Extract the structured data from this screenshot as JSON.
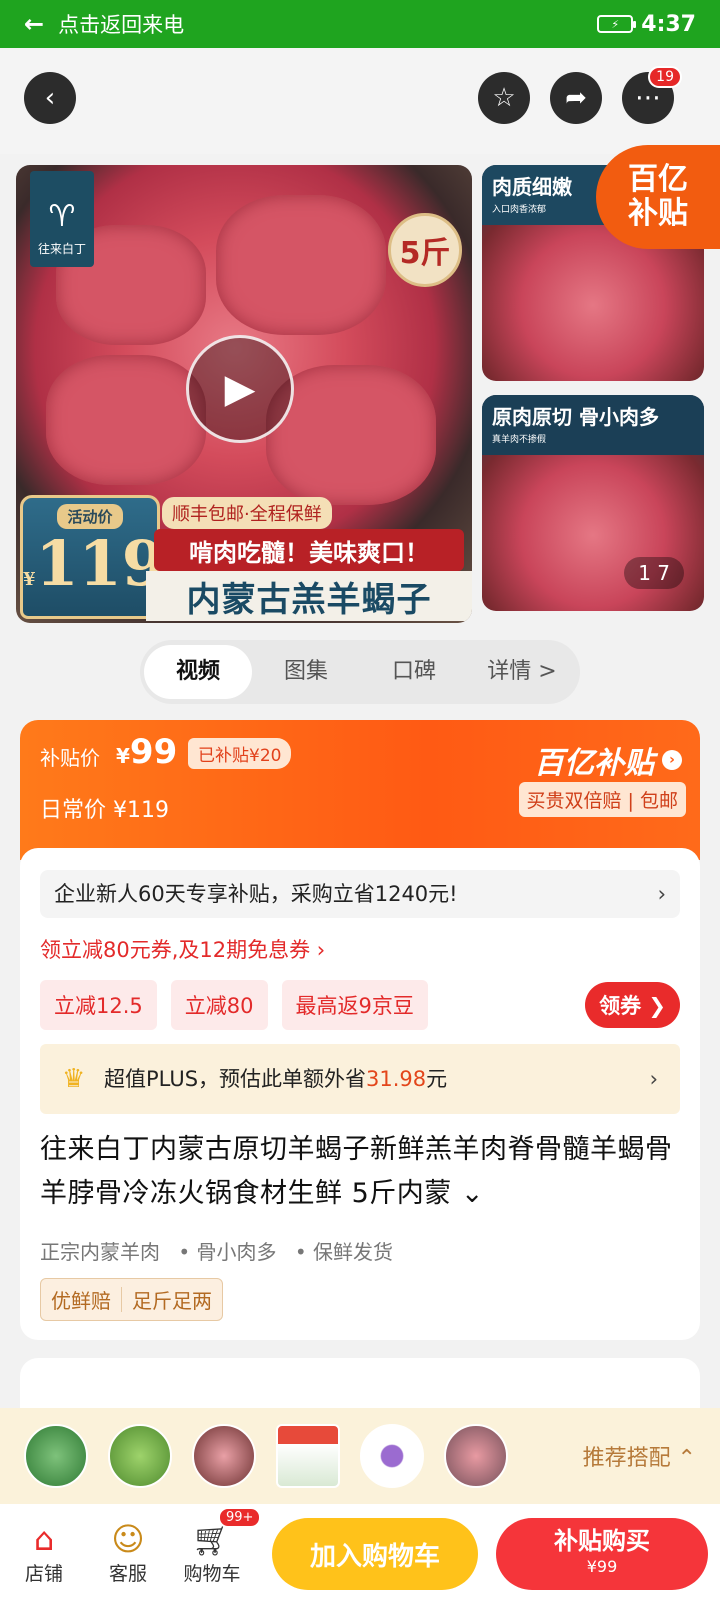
{
  "status_bar": {
    "back_text": "点击返回来电",
    "time": "4:37"
  },
  "nav": {
    "more_badge": "19"
  },
  "gallery": {
    "brand_logo": "往来白丁",
    "weight_tag": "5斤",
    "price_label": "活动价",
    "price_currency": "¥",
    "price_value": "119",
    "shipping_line": "顺丰包邮·全程保鲜",
    "slogan": "啃肉吃髓！美味爽口！",
    "product_banner": "内蒙古羔羊蝎子",
    "side1_caption": "肉质细嫩",
    "side1_sub": "入口肉香浓郁",
    "side2_caption": "原肉原切 骨小肉多",
    "side2_sub": "真羊肉不掺假",
    "subsidy_line1": "百亿",
    "subsidy_line2": "补贴",
    "page_indicator": "1 7"
  },
  "tabs": [
    {
      "label": "视频"
    },
    {
      "label": "图集"
    },
    {
      "label": "口碑"
    },
    {
      "label": "详情 >"
    }
  ],
  "price_panel": {
    "subsidy_label": "补贴价",
    "subsidy_currency": "¥",
    "subsidy_price": "99",
    "already_subsidized": "已补贴¥20",
    "daily_price": "日常价 ¥119",
    "brand": "百亿补贴",
    "guarantee": "买贵双倍赔 | 包邮"
  },
  "info": {
    "new_user_text": "企业新人60天专享补贴，采购立省1240元!",
    "coupon_link": "领立减80元券,及12期免息券 ›",
    "coupons": [
      "立减12.5",
      "立减80",
      "最高返9京豆"
    ],
    "get_coupon": "领券 ❯",
    "plus_prefix": "超值PLUS，预估此单额外省",
    "plus_amount": "31.98",
    "plus_suffix": "元",
    "title": "往来白丁内蒙古原切羊蝎子新鲜羔羊肉脊骨髓羊蝎骨羊脖骨冷冻火锅食材生鲜 5斤内蒙 ⌄",
    "features": [
      "正宗内蒙羊肉",
      "• 骨小肉多",
      "• 保鲜发货"
    ],
    "service_badges": [
      "优鲜赔",
      "足斤足两"
    ]
  },
  "recommend": {
    "label": "推荐搭配 ⌃"
  },
  "bottom": {
    "store": "店铺",
    "service": "客服",
    "cart": "购物车",
    "cart_badge": "99+",
    "add_to_cart": "加入购物车",
    "buy_now": "补贴购买",
    "buy_price": "¥99"
  },
  "colors": {
    "status_green": "#1fa41f",
    "subsidy_orange": "#ff5a14",
    "cart_yellow": "#ffc21a",
    "buy_red": "#f5353a"
  }
}
